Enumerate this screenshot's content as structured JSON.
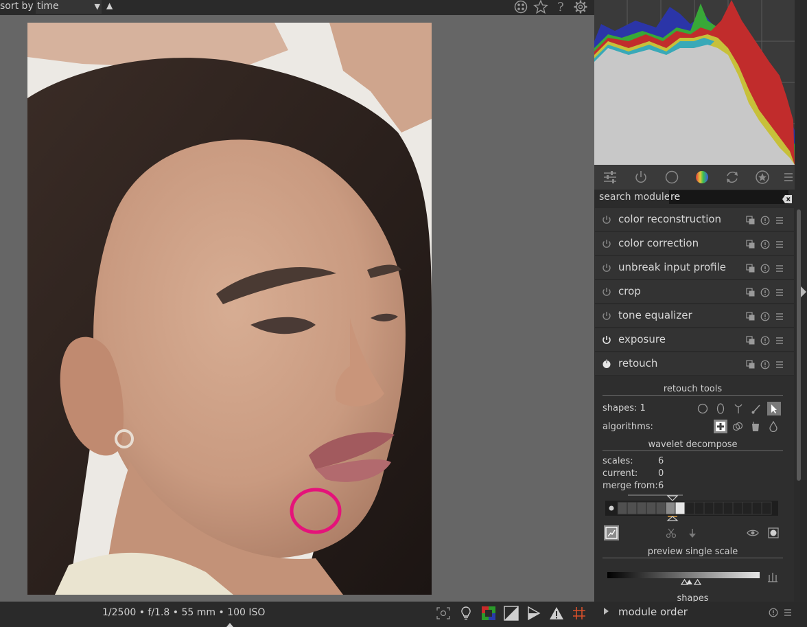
{
  "topbar": {
    "sort_label": "sort by",
    "sort_value": "time",
    "sort_caret": "▼",
    "sort_direction": "▲",
    "icons": [
      "grouping-icon",
      "star-icon",
      "help-icon",
      "gear-icon"
    ]
  },
  "photo": {
    "subject": "woman-portrait",
    "retouch_shape_color": "#e5137a"
  },
  "histogram": {
    "colors": {
      "red": "#c62b2b",
      "green": "#3aa83a",
      "blue": "#2a2aaa",
      "yellow": "#c9c23a",
      "cyan": "#3aa9b8",
      "gray": "#c8c8c8"
    }
  },
  "group_tabs": [
    "quick-access-icon",
    "active-modules-icon",
    "base-group-icon",
    "color-group-icon",
    "correct-group-icon",
    "effects-group-icon",
    "presets-menu-icon"
  ],
  "search": {
    "label": "search module",
    "value": "re"
  },
  "modules": [
    {
      "name": "color reconstruction",
      "enabled": false
    },
    {
      "name": "color correction",
      "enabled": false
    },
    {
      "name": "unbreak input profile",
      "enabled": false
    },
    {
      "name": "crop",
      "enabled": false
    },
    {
      "name": "tone equalizer",
      "enabled": false
    },
    {
      "name": "exposure",
      "enabled": true
    },
    {
      "name": "retouch",
      "enabled": true,
      "expanded": true
    }
  ],
  "retouch": {
    "tools_title": "retouch tools",
    "shapes_label": "shapes: 1",
    "algorithms_label": "algorithms:",
    "wavelet_title": "wavelet decompose",
    "scales_label": "scales:",
    "scales_value": "6",
    "current_label": "current:",
    "current_value": "0",
    "merge_label": "merge from:",
    "merge_value": "6",
    "preview_title": "preview single scale",
    "shapes_title": "shapes"
  },
  "statusbar": {
    "exif": "1/2500 • f/1.8 • 55 mm • 100 ISO",
    "module_order_label": "module order"
  }
}
